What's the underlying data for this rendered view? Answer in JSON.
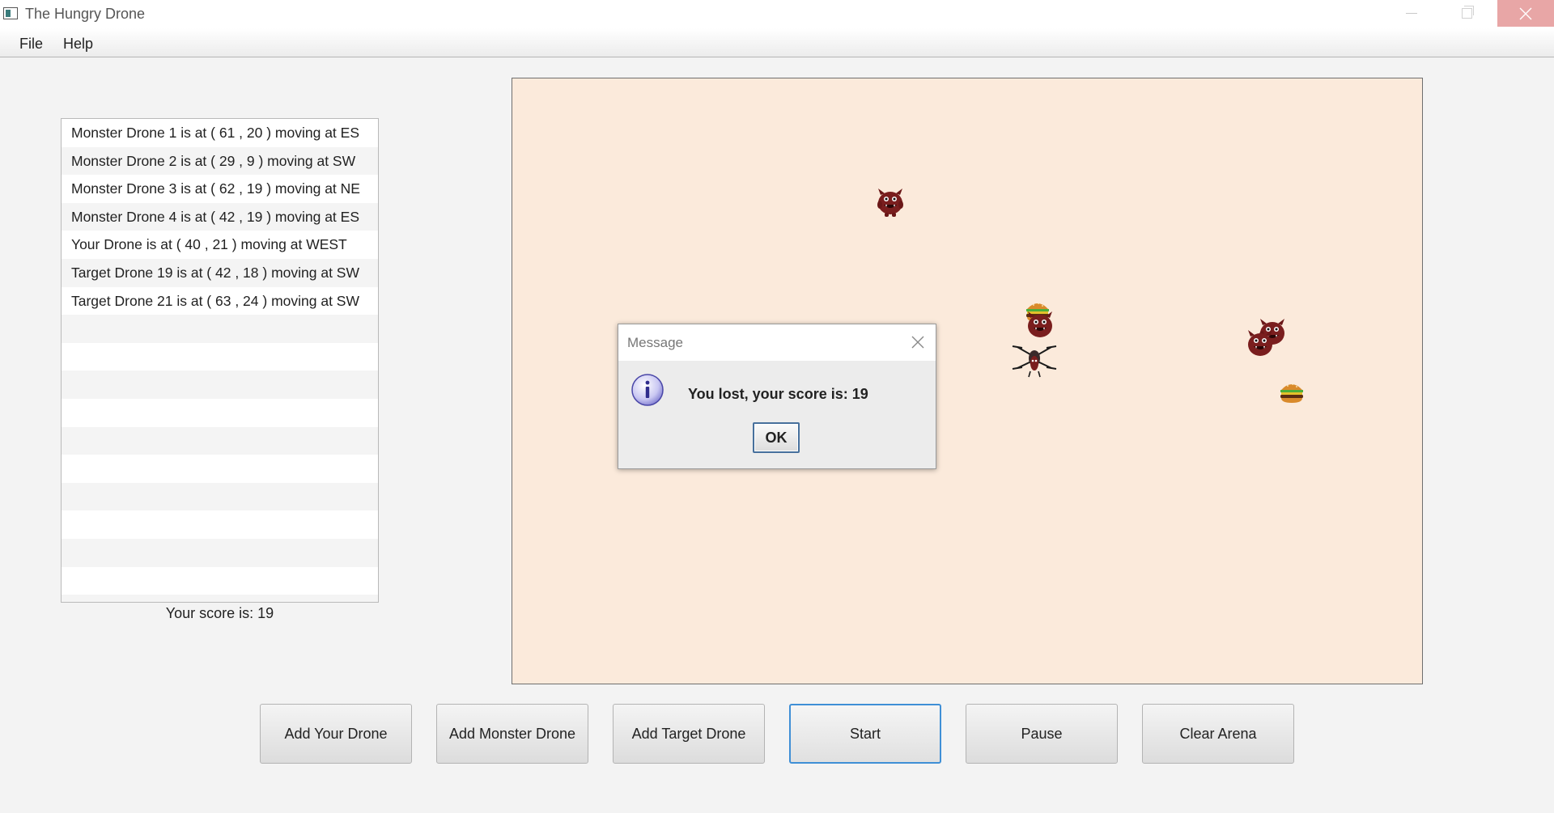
{
  "window": {
    "title": "The Hungry Drone"
  },
  "menu": {
    "items": [
      "File",
      "Help"
    ]
  },
  "status_list": {
    "rows": [
      "Monster Drone 1 is at ( 61 , 20 ) moving at ES",
      "Monster Drone 2 is at ( 29 , 9 ) moving at SW",
      "Monster Drone 3 is at ( 62 , 19 ) moving at NE",
      "Monster Drone 4 is at ( 42 , 19 ) moving at ES",
      "Your Drone is at ( 40 , 21 ) moving at WEST",
      "Target Drone 19 is at ( 42 , 18 ) moving at SW",
      "Target Drone 21 is at ( 63 , 24 ) moving at SW"
    ]
  },
  "score_label": "Your score is: 19",
  "dialog": {
    "title": "Message",
    "message": "You lost, your score is: 19",
    "ok_label": "OK"
  },
  "buttons": {
    "add_your_drone": "Add Your Drone",
    "add_monster_drone": "Add Monster Drone",
    "add_target_drone": "Add Target Drone",
    "start": "Start",
    "pause": "Pause",
    "clear_arena": "Clear Arena"
  },
  "colors": {
    "arena_background": "#fbeadb",
    "monster": "#7a1e1e",
    "focus_ring": "#3f8fd6"
  },
  "icons": {
    "monster": "monster-icon",
    "burger": "burger-icon",
    "drone": "drone-icon",
    "info": "info-icon"
  }
}
